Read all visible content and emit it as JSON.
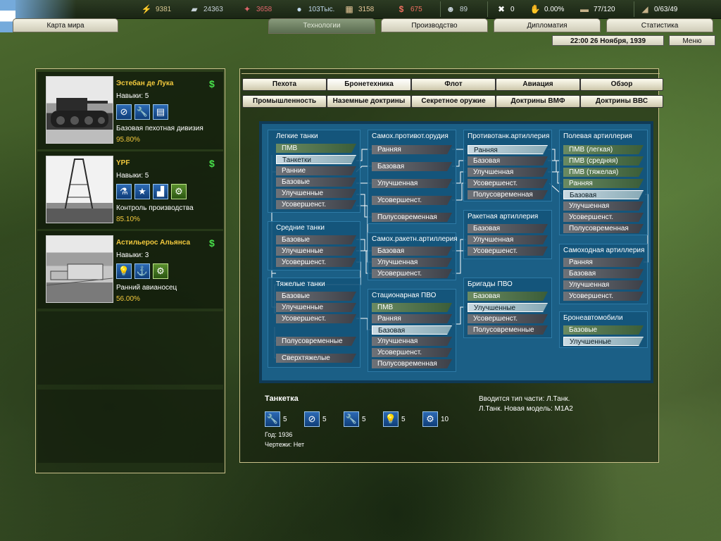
{
  "resources": [
    {
      "icon": "energy-icon",
      "glyph": "⚡",
      "value": "9381",
      "color": "#d6c690"
    },
    {
      "icon": "metal-icon",
      "glyph": "▰",
      "value": "24363",
      "color": "#c7d2d9"
    },
    {
      "icon": "rare-materials-icon",
      "glyph": "✦",
      "value": "3658",
      "color": "#e0666b"
    },
    {
      "icon": "oil-icon",
      "glyph": "💧",
      "value": "103Тыс.",
      "color": "#c0d8ec"
    },
    {
      "icon": "supplies-icon",
      "glyph": "▦",
      "value": "3158",
      "color": "#e8c99a"
    },
    {
      "icon": "money-icon",
      "glyph": "$",
      "value": "675",
      "color": "#f07060"
    },
    {
      "icon": "manpower-icon",
      "glyph": "☻",
      "value": "89",
      "color": "#c7d2d9"
    },
    {
      "icon": "transport-icon",
      "glyph": "✖",
      "value": "0",
      "color": "#ffffff"
    },
    {
      "icon": "dissent-icon",
      "glyph": "✋",
      "value": "0.00%",
      "color": "#ffffff"
    },
    {
      "icon": "convoys-icon",
      "glyph": "▬",
      "value": "77/120",
      "color": "#ffffff"
    },
    {
      "icon": "escorts-icon",
      "glyph": "◢",
      "value": "0/63/49",
      "color": "#ffffff"
    }
  ],
  "tabs": [
    "Карта мира",
    "Технологии",
    "Производство",
    "Дипломатия",
    "Статистика"
  ],
  "datetime": "22:00 26 Ноября, 1939",
  "menu_label": "Меню",
  "teams": [
    {
      "name": "Эстебан де Лука",
      "skill": "Навыки: 5",
      "spec": "Базовая пехотная дивизия",
      "pct": "95.80%",
      "icons": [
        "anti-tank-icon",
        "wrench-icon",
        "blueprint-icon"
      ]
    },
    {
      "name": "YPF",
      "skill": "Навыки: 5",
      "spec": "Контроль производства",
      "pct": "85.10%",
      "icons": [
        "flask-icon",
        "star-icon",
        "factory-icon",
        "gears-icon"
      ]
    },
    {
      "name": "Астильерос Альянса",
      "skill": "Навыки: 3",
      "spec": "Ранний авианосец",
      "pct": "56.00%",
      "icons": [
        "lightbulb-icon",
        "anchor-icon",
        "gears-icon"
      ]
    }
  ],
  "categories_row1": [
    "Пехота",
    "Бронетехника",
    "Флот",
    "Авиация",
    "Обзор"
  ],
  "categories_row2": [
    "Промышленность",
    "Наземные доктрины",
    "Секретное оружие",
    "Доктрины ВМФ",
    "Доктрины ВВС"
  ],
  "tree": {
    "light_tanks": {
      "title": "Легкие танки",
      "items": [
        "ПМВ",
        "Танкетки",
        "Ранние",
        "Базовые",
        "Улучшенные",
        "Усовершенст."
      ]
    },
    "medium_tanks": {
      "title": "Средние танки",
      "items": [
        "Базовые",
        "Улучшенные",
        "Усовершенст."
      ]
    },
    "heavy_tanks": {
      "title": "Тяжелые танки",
      "items": [
        "Базовые",
        "Улучшенные",
        "Усовершенст.",
        "Полусовременные",
        "Сверхтяжелые"
      ]
    },
    "sp_at": {
      "title": "Самох.противот.орудия",
      "items": [
        "Ранняя",
        "Базовая",
        "Улучшенная",
        "Усовершенст.",
        "Полусовременная"
      ]
    },
    "sp_rocket": {
      "title": "Самох.ракетн.артиллерия",
      "items": [
        "Базовая",
        "Улучшенная",
        "Усовершенст."
      ]
    },
    "static_aa": {
      "title": "Стационарная ПВО",
      "items": [
        "ПМВ",
        "Ранняя",
        "Базовая",
        "Улучшенная",
        "Усовершенст.",
        "Полусовременная"
      ]
    },
    "at_artillery": {
      "title": "Противотанк.артиллерия",
      "items": [
        "Ранняя",
        "Базовая",
        "Улучшенная",
        "Усовершенст.",
        "Полусовременная"
      ]
    },
    "rocket_artillery": {
      "title": "Ракетная артиллерия",
      "items": [
        "Базовая",
        "Улучшенная",
        "Усовершенст."
      ]
    },
    "aa_brigades": {
      "title": "Бригады ПВО",
      "items": [
        "Базовая",
        "Улучшенные",
        "Усовершенст.",
        "Полусовременные"
      ]
    },
    "field_artillery": {
      "title": "Полевая артиллерия",
      "items": [
        "ПМВ (легкая)",
        "ПМВ (средняя)",
        "ПМВ (тяжелая)",
        "Ранняя",
        "Базовая",
        "Улучшенная",
        "Усовершенст.",
        "Полусовременная"
      ]
    },
    "sp_artillery": {
      "title": "Самоходная артиллерия",
      "items": [
        "Ранняя",
        "Базовая",
        "Улучшенная",
        "Усовершенст."
      ]
    },
    "armored_cars": {
      "title": "Бронеавтомобили",
      "items": [
        "Базовые",
        "Улучшенные"
      ]
    }
  },
  "info": {
    "title": "Танкетка",
    "requirements": [
      {
        "icon": "wrench-icon",
        "glyph": "🔧",
        "value": "5"
      },
      {
        "icon": "anti-tank-icon",
        "glyph": "⊘",
        "value": "5"
      },
      {
        "icon": "wrench-icon",
        "glyph": "🔧",
        "value": "5"
      },
      {
        "icon": "lightbulb-icon",
        "glyph": "💡",
        "value": "5"
      },
      {
        "icon": "gears-icon",
        "glyph": "⚙",
        "value": "10"
      }
    ],
    "year": "Год: 1936",
    "blueprints": "Чертежи: Нет",
    "effect1": "Вводится тип части: Л.Танк.",
    "effect2": "Л.Танк. Новая модель: М1А2"
  }
}
